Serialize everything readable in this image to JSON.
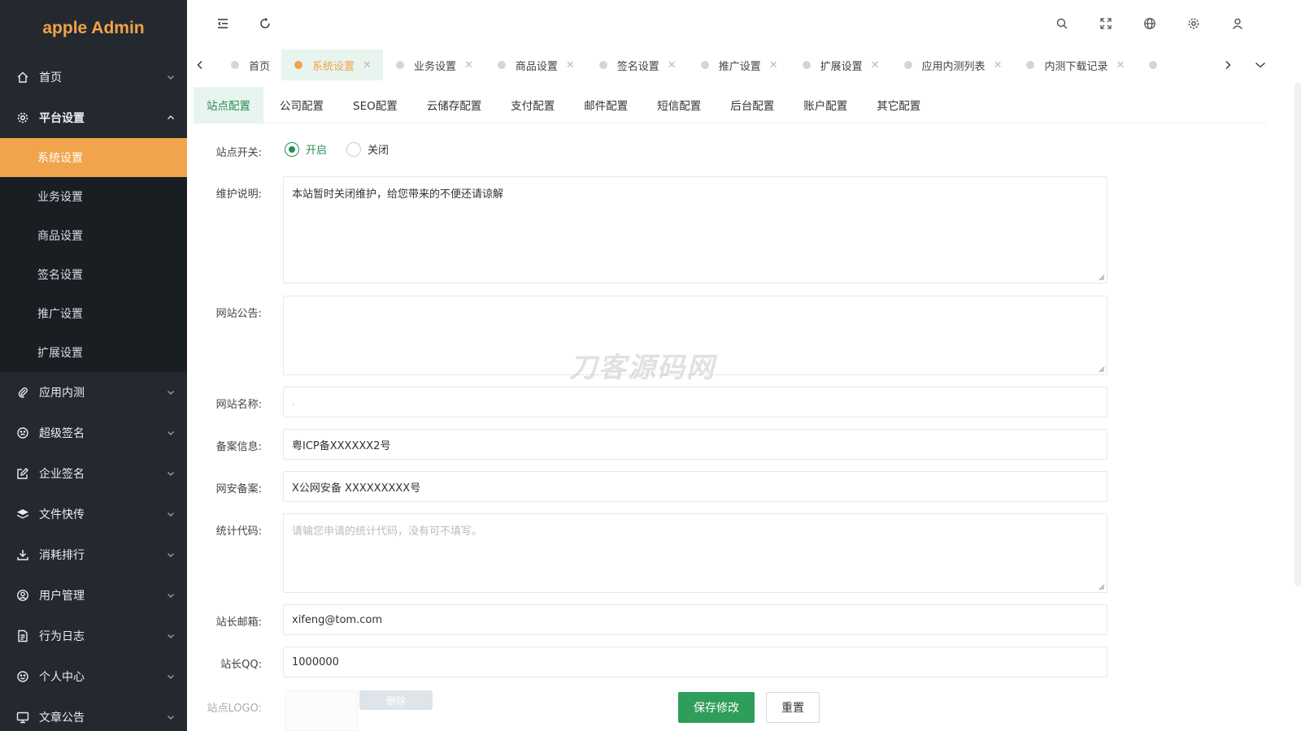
{
  "sidebar": {
    "logo": "apple Admin",
    "menu": [
      {
        "label": "首页",
        "icon": "home-icon",
        "open": false
      },
      {
        "label": "平台设置",
        "icon": "gear-icon",
        "open": true,
        "children": [
          "系统设置",
          "业务设置",
          "商品设置",
          "签名设置",
          "推广设置",
          "扩展设置"
        ],
        "active_child": "系统设置"
      },
      {
        "label": "应用内测",
        "icon": "paperclip-icon",
        "open": false
      },
      {
        "label": "超级签名",
        "icon": "smile-icon",
        "open": false
      },
      {
        "label": "企业签名",
        "icon": "edit-icon",
        "open": false
      },
      {
        "label": "文件快传",
        "icon": "layers-icon",
        "open": false
      },
      {
        "label": "消耗排行",
        "icon": "download-icon",
        "open": false
      },
      {
        "label": "用户管理",
        "icon": "user-circle-icon",
        "open": false
      },
      {
        "label": "行为日志",
        "icon": "file-icon",
        "open": false
      },
      {
        "label": "个人中心",
        "icon": "smile-icon",
        "open": false
      },
      {
        "label": "文章公告",
        "icon": "monitor-icon",
        "open": false
      }
    ]
  },
  "header": {
    "icons": [
      "menu-fold-icon",
      "refresh-icon",
      "search-icon",
      "fullscreen-icon",
      "globe-icon",
      "gear-icon",
      "user-icon"
    ]
  },
  "tabs": [
    {
      "label": "首页",
      "active": false,
      "closable": false
    },
    {
      "label": "系统设置",
      "active": true,
      "closable": true
    },
    {
      "label": "业务设置",
      "active": false,
      "closable": true
    },
    {
      "label": "商品设置",
      "active": false,
      "closable": true
    },
    {
      "label": "签名设置",
      "active": false,
      "closable": true
    },
    {
      "label": "推广设置",
      "active": false,
      "closable": true
    },
    {
      "label": "扩展设置",
      "active": false,
      "closable": true
    },
    {
      "label": "应用内测列表",
      "active": false,
      "closable": true
    },
    {
      "label": "内测下载记录",
      "active": false,
      "closable": true
    }
  ],
  "subtabs": [
    "站点配置",
    "公司配置",
    "SEO配置",
    "云储存配置",
    "支付配置",
    "邮件配置",
    "短信配置",
    "后台配置",
    "账户配置",
    "其它配置"
  ],
  "active_subtab": "站点配置",
  "form": {
    "site_switch": {
      "label": "站点开关:",
      "options": [
        "开启",
        "关闭"
      ],
      "selected": "开启"
    },
    "maintenance": {
      "label": "维护说明:",
      "value": "本站暂时关闭维护，给您带来的不便还请谅解"
    },
    "notice": {
      "label": "网站公告:",
      "value": ""
    },
    "site_name": {
      "label": "网站名称:",
      "value": "."
    },
    "icp": {
      "label": "备案信息:",
      "value": "粤ICP备XXXXXX2号"
    },
    "police": {
      "label": "网安备案:",
      "value": "X公网安备 XXXXXXXXX号"
    },
    "stats": {
      "label": "统计代码:",
      "value": "",
      "placeholder": "请输您申请的统计代码，没有可不填写。"
    },
    "email": {
      "label": "站长邮箱:",
      "value": "xifeng@tom.com"
    },
    "qq": {
      "label": "站长QQ:",
      "value": "1000000"
    },
    "logo": {
      "label": "站点LOGO:",
      "delete_label": "删除"
    }
  },
  "buttons": {
    "save": "保存修改",
    "reset": "重置"
  },
  "watermark": "刀客源码网",
  "colors": {
    "accent": "#f0a54c",
    "primary": "#2f9e5a",
    "sidebar_bg": "#23292f"
  }
}
